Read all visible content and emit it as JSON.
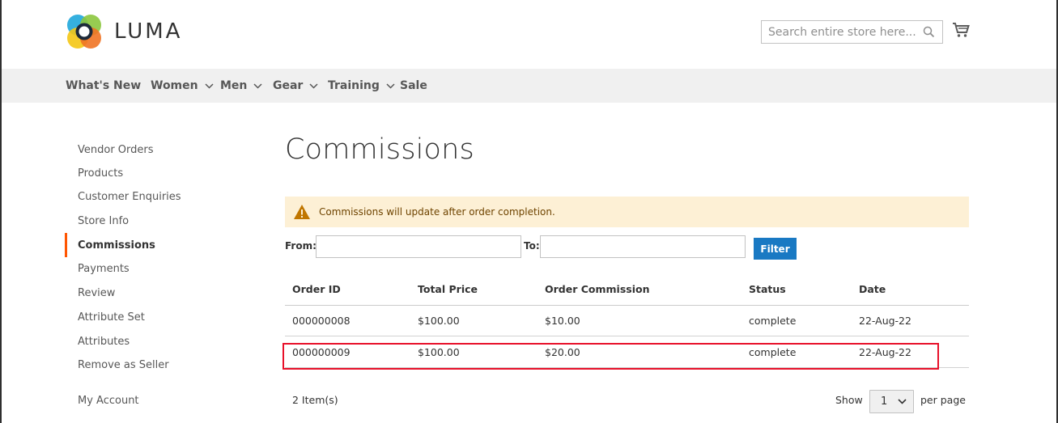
{
  "brand": {
    "name": "LUMA"
  },
  "search": {
    "placeholder": "Search entire store here..."
  },
  "nav": {
    "items": [
      {
        "label": "What's New",
        "dropdown": false
      },
      {
        "label": "Women",
        "dropdown": true
      },
      {
        "label": "Men",
        "dropdown": true
      },
      {
        "label": "Gear",
        "dropdown": true
      },
      {
        "label": "Training",
        "dropdown": true
      },
      {
        "label": "Sale",
        "dropdown": false
      }
    ]
  },
  "sidebar": {
    "items": [
      {
        "label": "Vendor Orders",
        "active": false
      },
      {
        "label": "Products",
        "active": false
      },
      {
        "label": "Customer Enquiries",
        "active": false
      },
      {
        "label": "Store Info",
        "active": false
      },
      {
        "label": "Commissions",
        "active": true
      },
      {
        "label": "Payments",
        "active": false
      },
      {
        "label": "Review",
        "active": false
      },
      {
        "label": "Attribute Set",
        "active": false
      },
      {
        "label": "Attributes",
        "active": false
      },
      {
        "label": "Remove as Seller",
        "active": false
      }
    ],
    "account": {
      "label": "My Account"
    }
  },
  "page": {
    "title": "Commissions",
    "notice": "Commissions will update after order completion.",
    "filter": {
      "from_label": "From:",
      "to_label": "To:",
      "button": "Filter",
      "from_value": "",
      "to_value": ""
    }
  },
  "table": {
    "headers": [
      "Order ID",
      "Total Price",
      "Order Commission",
      "Status",
      "Date"
    ],
    "rows": [
      [
        "000000008",
        "$100.00",
        "$10.00",
        "complete",
        "22-Aug-22"
      ],
      [
        "000000009",
        "$100.00",
        "$20.00",
        "complete",
        "22-Aug-22"
      ]
    ]
  },
  "pager": {
    "count": "2 Item(s)",
    "show_label": "Show",
    "limit_value": "1",
    "per_page_label": "per page"
  },
  "colors": {
    "accent": "#1979c3",
    "active_marker": "#ff5501",
    "notice_bg": "#fdf0d5",
    "highlight": "#e8102a"
  }
}
